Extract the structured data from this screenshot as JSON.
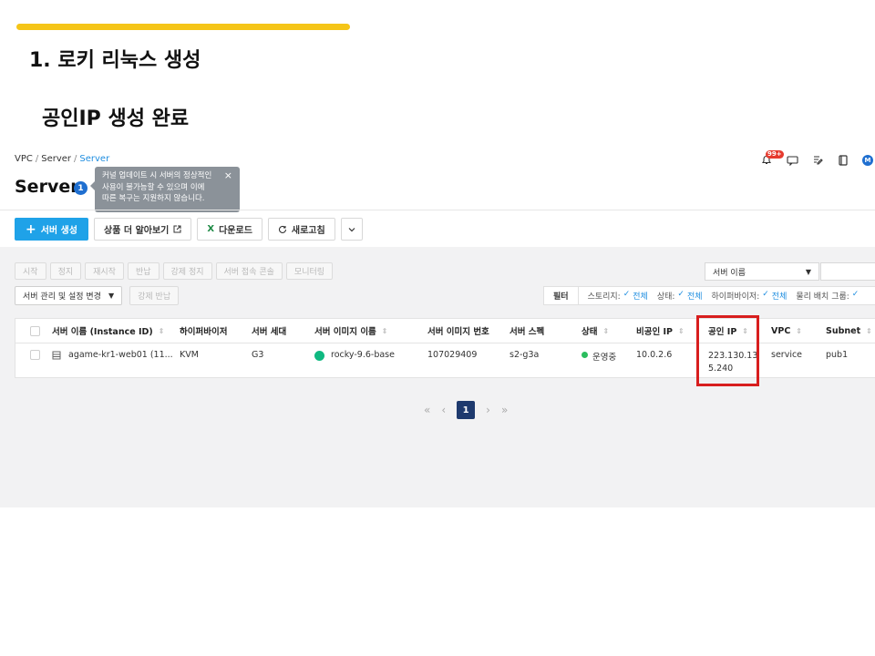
{
  "slide": {
    "title": "1. 로키 리눅스 생성",
    "subtitle": "공인IP 생성 완료",
    "accent_color": "#f5c518"
  },
  "breadcrumb": [
    "VPC",
    "Server",
    "Server"
  ],
  "header": {
    "notification_badge": "99+",
    "avatar_initial": "M",
    "icons": [
      "bell-icon",
      "chat-icon",
      "edit-icon",
      "book-icon",
      "avatar"
    ]
  },
  "page": {
    "title": "Server",
    "info_count": "1",
    "tooltip": {
      "lines": [
        "커널 업데이트 시 서버의 정상적인",
        "사용이 불가능할 수 있으며 이에",
        "따른 복구는 지원하지 않습니다."
      ],
      "close": "×"
    }
  },
  "toolbar": {
    "create": "서버 생성",
    "more_products": "상품 더 알아보기",
    "download": "다운로드",
    "refresh": "새로고침",
    "create_color": "#1fa2e8"
  },
  "actions": [
    "시작",
    "정지",
    "재시작",
    "반납",
    "강제 정지",
    "서버 접속 콘솔",
    "모니터링"
  ],
  "management": {
    "settings": "서버 관리 및 설정 변경",
    "force_return": "강제 반납"
  },
  "search": {
    "field": "서버 이름"
  },
  "filter": {
    "label": "필터",
    "items": [
      {
        "name": "스토리지:",
        "value": "전체"
      },
      {
        "name": "상태:",
        "value": "전체"
      },
      {
        "name": "하이퍼바이저:",
        "value": "전체"
      },
      {
        "name": "물리 배치 그룹:",
        "value": ""
      }
    ]
  },
  "table": {
    "headers": [
      "서버 이름 (Instance ID)",
      "하이퍼바이저",
      "서버 세대",
      "서버 이미지 이름",
      "서버 이미지 번호",
      "서버 스펙",
      "상태",
      "비공인 IP",
      "공인 IP",
      "VPC",
      "Subnet"
    ],
    "rows": [
      {
        "name": "agame-kr1-web01 (11...",
        "hypervisor": "KVM",
        "generation": "G3",
        "image_name": "rocky-9.6-base",
        "image_no": "107029409",
        "spec": "s2-g3a",
        "status": "운영중",
        "private_ip": "10.0.2.6",
        "public_ip_line1": "223.130.13",
        "public_ip_line2": "5.240",
        "vpc": "service",
        "subnet": "pub1"
      }
    ]
  },
  "pagination": {
    "first": "«",
    "prev": "‹",
    "current": "1",
    "next": "›",
    "last": "»"
  },
  "highlight_color": "#d81e1e"
}
